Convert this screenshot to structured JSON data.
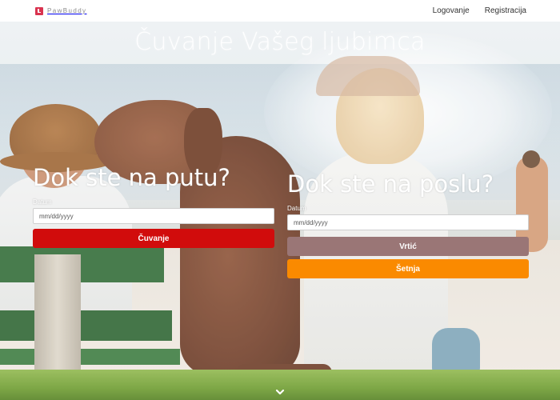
{
  "navbar": {
    "brand_name": "PawBuddy",
    "links": [
      {
        "label": "Logovanje"
      },
      {
        "label": "Registracija"
      }
    ]
  },
  "hero": {
    "title": "Čuvanje Vašeg ljubimca"
  },
  "panels": {
    "travel": {
      "heading": "Dok ste na putu?",
      "date_label": "Datum",
      "date_placeholder": "mm/dd/yyyy",
      "buttons": [
        {
          "label": "Čuvanje",
          "color": "#d10c0c"
        }
      ]
    },
    "work": {
      "heading": "Dok ste na poslu?",
      "date_label": "Datum",
      "date_placeholder": "mm/dd/yyyy",
      "buttons": [
        {
          "label": "Vrtić",
          "color": "#9a7676"
        },
        {
          "label": "Šetnja",
          "color": "#fa8a00"
        }
      ]
    }
  },
  "icons": {
    "brand_logo": "pawbuddy-logo-icon",
    "scroll_down": "chevron-down-icon"
  },
  "colors": {
    "brand": "#d9334f",
    "navbar_bg": "#ffffff"
  }
}
